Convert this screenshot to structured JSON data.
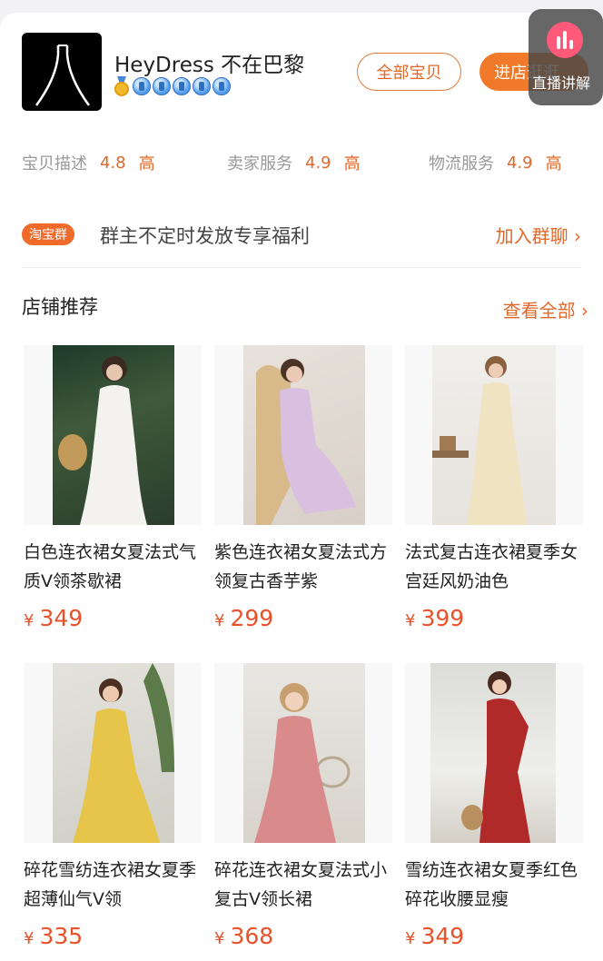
{
  "shop": {
    "name": "HeyDress 不在巴黎",
    "all_items_label": "全部宝贝",
    "enter_shop_label": "进店逛逛",
    "live_label": "直播讲解"
  },
  "ratings": [
    {
      "label": "宝贝描述",
      "value": "4.8",
      "level": "高"
    },
    {
      "label": "卖家服务",
      "value": "4.9",
      "level": "高"
    },
    {
      "label": "物流服务",
      "value": "4.9",
      "level": "高"
    }
  ],
  "group": {
    "tag": "淘宝群",
    "text": "群主不定时发放专享福利",
    "join_label": "加入群聊 ›"
  },
  "section": {
    "title": "店铺推荐",
    "more_label": "查看全部 ›"
  },
  "products": [
    {
      "name": "白色连衣裙女夏法式气质V领茶歇裙",
      "currency": "¥",
      "price": "349"
    },
    {
      "name": "紫色连衣裙女夏法式方领复古香芋紫",
      "currency": "¥",
      "price": "299"
    },
    {
      "name": "法式复古连衣裙夏季女宫廷风奶油色",
      "currency": "¥",
      "price": "399"
    },
    {
      "name": "碎花雪纺连衣裙女夏季超薄仙气V领",
      "currency": "¥",
      "price": "335"
    },
    {
      "name": "碎花连衣裙女夏法式小复古V领长裙",
      "currency": "¥",
      "price": "368"
    },
    {
      "name": "雪纺连衣裙女夏季红色碎花收腰显瘦",
      "currency": "¥",
      "price": "349"
    }
  ],
  "colors": {
    "accent": "#f07a2a",
    "price": "#e8522a"
  }
}
